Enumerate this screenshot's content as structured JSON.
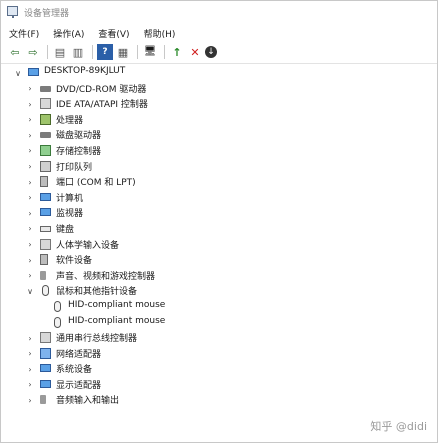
{
  "window": {
    "title": "设备管理器"
  },
  "menu": [
    "文件(F)",
    "操作(A)",
    "查看(V)",
    "帮助(H)"
  ],
  "toolbar": {
    "back": "⇦",
    "forward": "⇨",
    "view1": "▤",
    "view2": "▥",
    "help": "?",
    "props": "▦",
    "scan": "🖥",
    "enable": "↑",
    "uninstall": "✕",
    "update": "↓"
  },
  "tree": {
    "root": "DESKTOP-89KJLUT",
    "items": [
      {
        "label": "DVD/CD-ROM 驱动器",
        "icon": "disk-icon",
        "expanded": false
      },
      {
        "label": "IDE ATA/ATAPI 控制器",
        "icon": "controller-icon",
        "expanded": false
      },
      {
        "label": "处理器",
        "icon": "processor-icon",
        "expanded": false
      },
      {
        "label": "磁盘驱动器",
        "icon": "disk-drive-icon",
        "expanded": false
      },
      {
        "label": "存储控制器",
        "icon": "storage-icon",
        "expanded": false
      },
      {
        "label": "打印队列",
        "icon": "printer-icon",
        "expanded": false
      },
      {
        "label": "端口 (COM 和 LPT)",
        "icon": "port-icon",
        "expanded": false
      },
      {
        "label": "计算机",
        "icon": "computer-icon",
        "expanded": false
      },
      {
        "label": "监视器",
        "icon": "monitor-icon",
        "expanded": false
      },
      {
        "label": "键盘",
        "icon": "keyboard-icon",
        "expanded": false
      },
      {
        "label": "人体学输入设备",
        "icon": "hid-icon",
        "expanded": false
      },
      {
        "label": "软件设备",
        "icon": "software-icon",
        "expanded": false
      },
      {
        "label": "声音、视频和游戏控制器",
        "icon": "sound-icon",
        "expanded": false
      },
      {
        "label": "鼠标和其他指针设备",
        "icon": "mouse-icon",
        "expanded": true,
        "children": [
          {
            "label": "HID-compliant mouse",
            "icon": "mouse-icon"
          },
          {
            "label": "HID-compliant mouse",
            "icon": "mouse-icon"
          }
        ]
      },
      {
        "label": "通用串行总线控制器",
        "icon": "usb-icon",
        "expanded": false
      },
      {
        "label": "网络适配器",
        "icon": "network-icon",
        "expanded": false
      },
      {
        "label": "系统设备",
        "icon": "system-icon",
        "expanded": false
      },
      {
        "label": "显示适配器",
        "icon": "display-icon",
        "expanded": false
      },
      {
        "label": "音频输入和输出",
        "icon": "audio-icon",
        "expanded": false
      }
    ]
  },
  "watermark": "知乎 @didi"
}
